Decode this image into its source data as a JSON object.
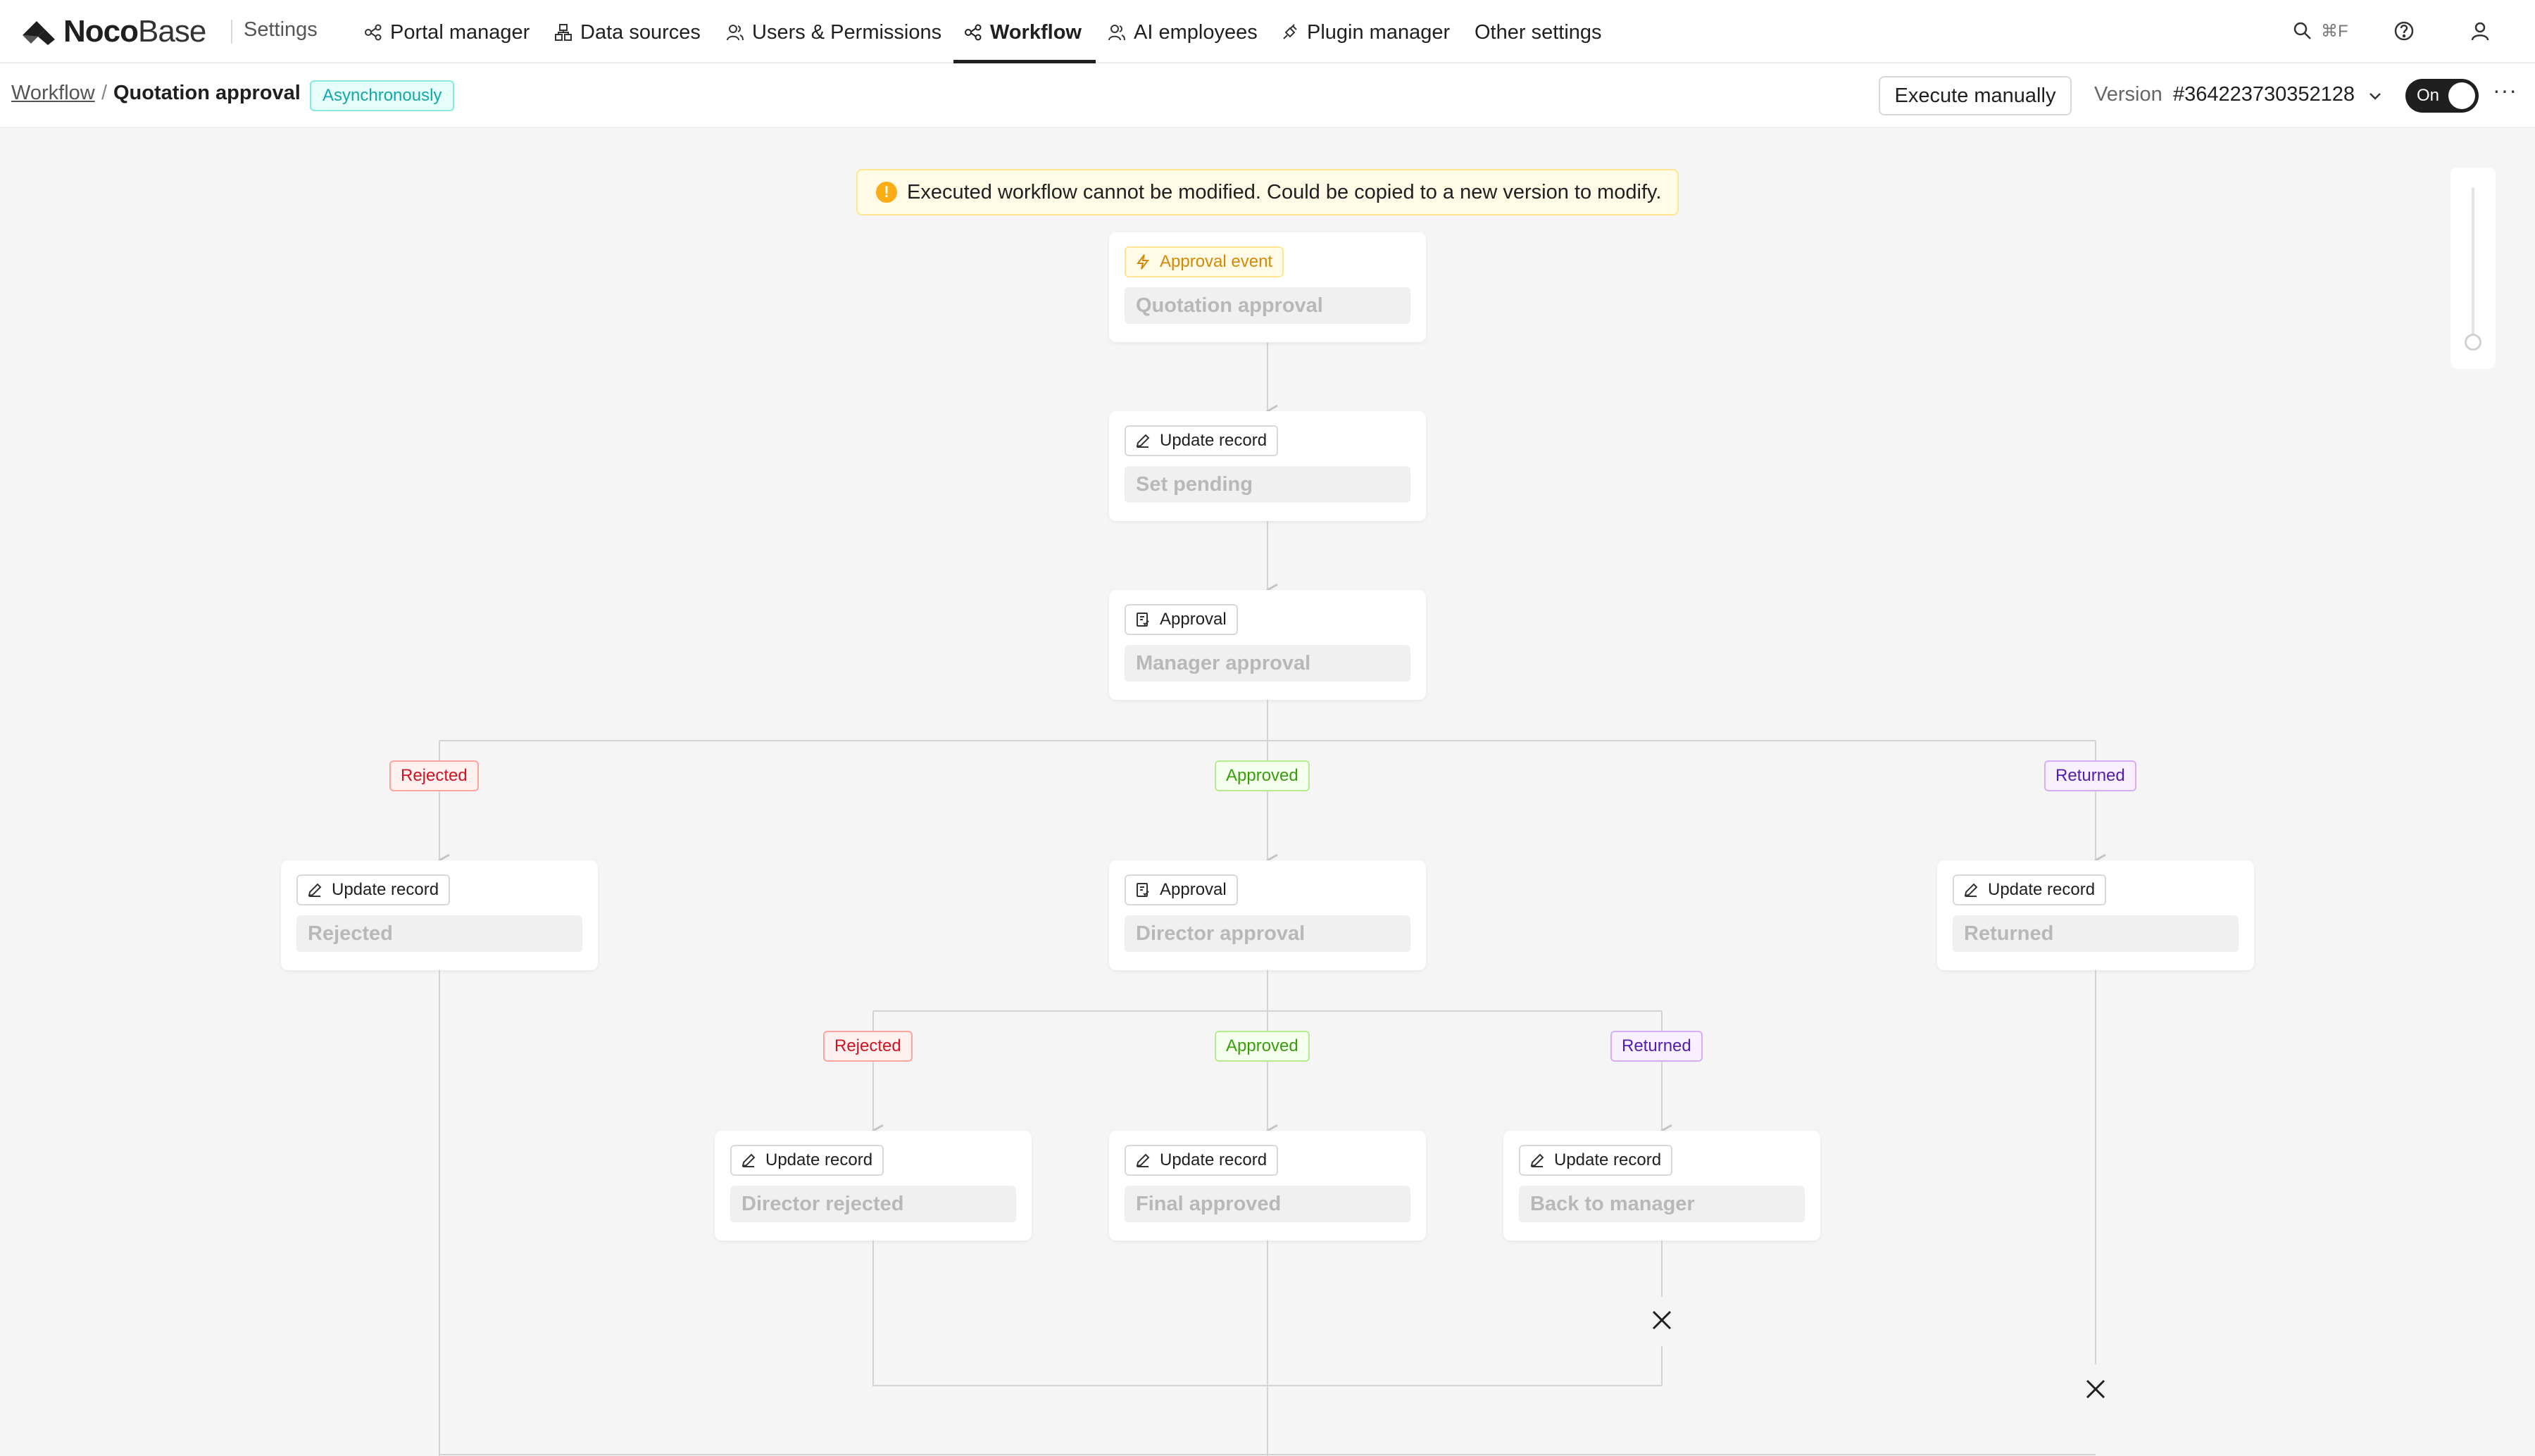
{
  "brand": {
    "name_bold": "Noco",
    "name_light": "Base",
    "section": "Settings"
  },
  "nav": {
    "items": [
      {
        "label": "Portal manager",
        "icon": "portal-icon"
      },
      {
        "label": "Data sources",
        "icon": "database-icon"
      },
      {
        "label": "Users & Permissions",
        "icon": "users-icon"
      },
      {
        "label": "Workflow",
        "icon": "workflow-icon",
        "active": true
      },
      {
        "label": "AI employees",
        "icon": "ai-employee-icon"
      },
      {
        "label": "Plugin manager",
        "icon": "plugin-icon"
      },
      {
        "label": "Other settings"
      }
    ],
    "search_shortcut": "⌘F"
  },
  "header": {
    "breadcrumb_root": "Workflow",
    "separator": "/",
    "title": "Quotation approval",
    "mode_tag": "Asynchronously",
    "execute_button": "Execute manually",
    "version_label": "Version",
    "version_value": "#364223730352128",
    "toggle_label": "On",
    "more": "···"
  },
  "alert": {
    "text": "Executed workflow cannot be modified. Could be copied to a new version to modify."
  },
  "nodes": {
    "trigger": {
      "type": "Approval event",
      "title": "Quotation approval"
    },
    "set_pending": {
      "type": "Update record",
      "title": "Set pending"
    },
    "manager_approval": {
      "type": "Approval",
      "title": "Manager approval"
    },
    "mgr_rejected": {
      "type": "Update record",
      "title": "Rejected"
    },
    "director_approval": {
      "type": "Approval",
      "title": "Director approval"
    },
    "mgr_returned": {
      "type": "Update record",
      "title": "Returned"
    },
    "director_rejected": {
      "type": "Update record",
      "title": "Director rejected"
    },
    "final_approved": {
      "type": "Update record",
      "title": "Final approved"
    },
    "back_to_manager": {
      "type": "Update record",
      "title": "Back to manager"
    }
  },
  "branches": {
    "rejected": "Rejected",
    "approved": "Approved",
    "returned": "Returned"
  },
  "colors": {
    "rejected": "#cf1322",
    "approved": "#389e0d",
    "returned": "#531dab",
    "trigger": "#d48806"
  }
}
